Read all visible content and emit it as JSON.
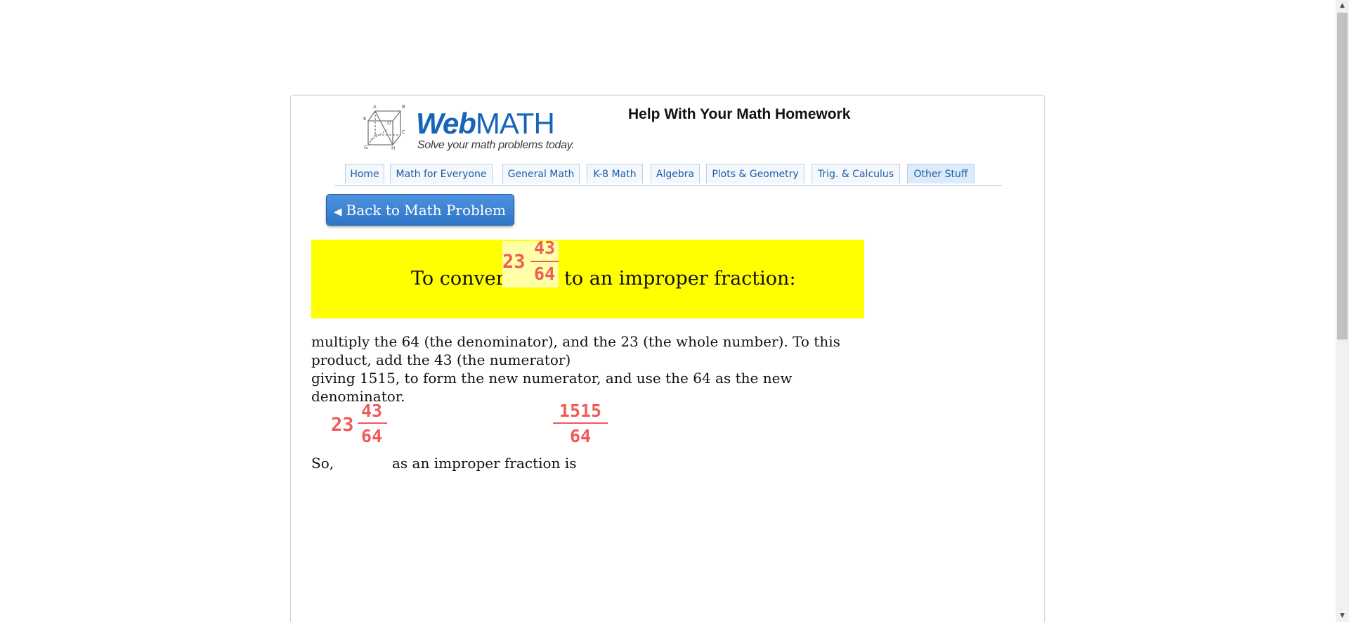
{
  "header": {
    "logo_web": "Web",
    "logo_math": "MATH",
    "logo_tagline": "Solve your math problems today.",
    "title": "Help With Your Math Homework"
  },
  "nav": {
    "tabs": [
      {
        "label": "Home",
        "active": false
      },
      {
        "label": "Math for Everyone",
        "active": false
      },
      {
        "label": "General Math",
        "active": false
      },
      {
        "label": "K-8 Math",
        "active": false
      },
      {
        "label": "Algebra",
        "active": false
      },
      {
        "label": "Plots & Geometry",
        "active": false
      },
      {
        "label": "Trig. & Calculus",
        "active": false
      },
      {
        "label": "Other Stuff",
        "active": true
      }
    ]
  },
  "back_button": {
    "arrow": "◀",
    "label": "Back to Math Problem"
  },
  "intro": {
    "prefix": "To convert",
    "suffix": "to an improper fraction:",
    "mixed": {
      "whole": "23",
      "numerator": "43",
      "denominator": "64"
    }
  },
  "explanation": {
    "line1": "multiply the 64 (the denominator), and the 23 (the whole number). To this product, add the 43 (the numerator)",
    "line2": "giving 1515, to form the new numerator, and use the 64 as the new denominator."
  },
  "conclusion": {
    "prefix": "So,",
    "middle": "as an improper fraction is",
    "mixed": {
      "whole": "23",
      "numerator": "43",
      "denominator": "64"
    },
    "result": {
      "numerator": "1515",
      "denominator": "64"
    }
  },
  "colors": {
    "brand_blue": "#1565b8",
    "fraction_red": "#f25a5a",
    "highlight_yellow": "#ffff00"
  }
}
